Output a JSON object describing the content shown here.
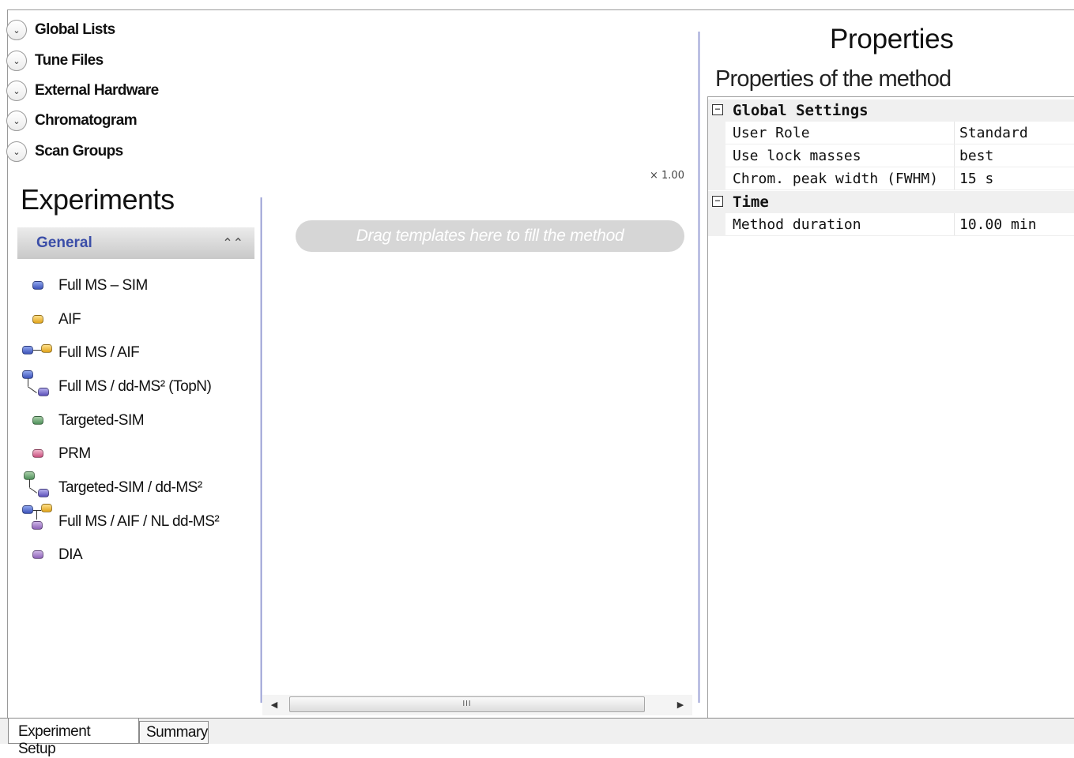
{
  "expanders": [
    {
      "label": "Global Lists"
    },
    {
      "label": "Tune Files"
    },
    {
      "label": "External Hardware"
    },
    {
      "label": "Chromatogram"
    },
    {
      "label": "Scan Groups"
    }
  ],
  "experiments": {
    "title": "Experiments",
    "group_label": "General",
    "items": [
      {
        "label": "Full MS – SIM",
        "icon": "blue-node-icon"
      },
      {
        "label": "AIF",
        "icon": "gold-node-icon"
      },
      {
        "label": "Full MS / AIF",
        "icon": "blue-gold-pair-icon"
      },
      {
        "label": "Full MS / dd-MS² (TopN)",
        "icon": "blue-to-violet-branch-icon"
      },
      {
        "label": "Targeted-SIM",
        "icon": "green-node-icon"
      },
      {
        "label": "PRM",
        "icon": "pink-node-icon"
      },
      {
        "label": "Targeted-SIM / dd-MS²",
        "icon": "green-to-violet-branch-icon"
      },
      {
        "label": "Full MS / AIF / NL dd-MS²",
        "icon": "blue-gold-violet-tree-icon"
      },
      {
        "label": "DIA",
        "icon": "purple-node-icon"
      }
    ]
  },
  "canvas": {
    "zoom": "× 1.00",
    "drop_hint": "Drag templates here to fill the method",
    "scroll_grip": "III"
  },
  "properties": {
    "title": "Properties",
    "subtitle": "Properties of the method",
    "categories": [
      {
        "label": "Global Settings",
        "toggle": "⊟",
        "rows": [
          {
            "name": "User Role",
            "value": "Standard"
          },
          {
            "name": "Use lock masses",
            "value": "best"
          },
          {
            "name": "Chrom. peak width (FWHM)",
            "value": "15 s"
          }
        ]
      },
      {
        "label": "Time",
        "toggle": "⊟",
        "rows": [
          {
            "name": "Method duration",
            "value": "10.00 min"
          }
        ]
      }
    ]
  },
  "tabs": [
    {
      "label": "Experiment Setup",
      "active": true
    },
    {
      "label": "Summary",
      "active": false
    }
  ]
}
